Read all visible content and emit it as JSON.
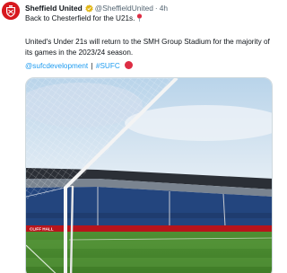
{
  "tweet": {
    "author_name": "Sheffield United",
    "handle": "@SheffieldUnited",
    "separator": "·",
    "time": "4h",
    "line1": "Back to Chesterfield for the U21s.",
    "paragraph_line1": "United's Under 21s will return to the SMH Group Stadium for the majority of",
    "paragraph_line2": "its games in the 2023/24 season.",
    "hashtag1": "@sufcdevelopment",
    "tag_separator": "|",
    "hashtag2": "#SUFC",
    "pitch_board_text": "CLIFF HALL"
  },
  "colors": {
    "brand_red": "#d7191f",
    "link_blue": "#1d9bf0",
    "verified_gold": "#e2b719",
    "muted_text": "#536471"
  },
  "icons": {
    "verified": "verified-badge-icon",
    "pin": "round-pushpin-icon",
    "dot": "red-circle-emoji-icon"
  }
}
